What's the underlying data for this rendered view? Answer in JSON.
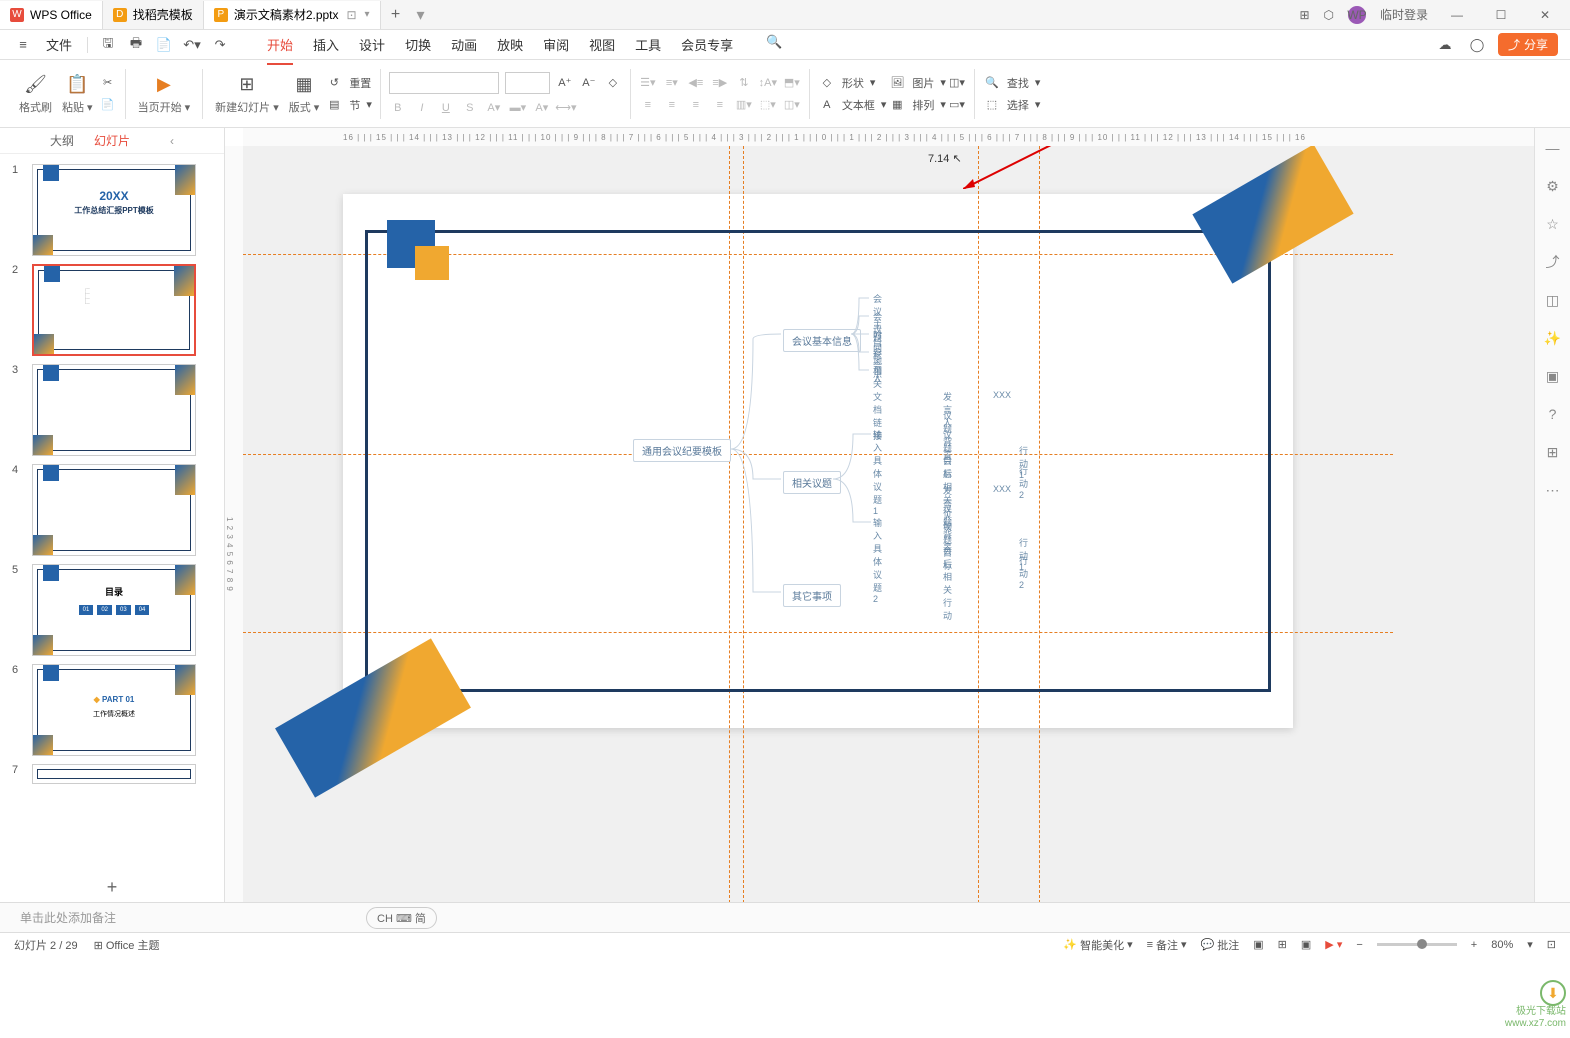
{
  "titlebar": {
    "tabs": [
      {
        "icon": "W",
        "label": "WPS Office",
        "iconColor": "red"
      },
      {
        "icon": "D",
        "label": "找稻壳模板",
        "iconColor": "orange"
      },
      {
        "icon": "P",
        "label": "演示文稿素材2.pptx",
        "iconColor": "orange",
        "active": true
      }
    ],
    "login": "临时登录"
  },
  "menu": {
    "file": "文件",
    "tabs": [
      "开始",
      "插入",
      "设计",
      "切换",
      "动画",
      "放映",
      "审阅",
      "视图",
      "工具",
      "会员专享"
    ],
    "activeTab": "开始",
    "share": "分享"
  },
  "ribbon": {
    "formatBrush": "格式刷",
    "paste": "粘贴",
    "startSlide": "当页开始",
    "newSlide": "新建幻灯片",
    "layout": "版式",
    "reset": "重置",
    "section": "节",
    "shape": "形状",
    "picture": "图片",
    "textbox": "文本框",
    "arrange": "排列",
    "find": "查找",
    "select": "选择"
  },
  "panel": {
    "outline": "大纲",
    "slides": "幻灯片"
  },
  "canvas": {
    "cursorValue": "7.14",
    "rulerH": "16 | | | 15 | | | 14 | | | 13 | | | 12 | | | 11 | | | 10 | | | 9 | | | 8 | | | 7 | | | 6 | | | 5 | | | 4 | | | 3 | | | 2 | | | 1 | | | 0 | | | 1 | | | 2 | | | 3 | | | 4 | | | 5 | | | 6 | | | 7 | | | 8 | | | 9 | | | 10 | | | 11 | | | 12 | | | 13 | | | 14 | | | 15 | | | 16",
    "rulerV": "1 2 3 4 5 6 7 8 9"
  },
  "mindmap": {
    "root": "通用会议纪要模板",
    "branch1": {
      "label": "会议基本信息",
      "children": [
        "会议主题",
        "会议目标",
        "时间地点",
        "参会人",
        "相关文档链接"
      ]
    },
    "branch2": {
      "label": "相关议题",
      "children": [
        {
          "label": "输入具体议题1",
          "sub": [
            "发言人",
            "议题背景",
            "议题目标"
          ],
          "xxx": "XXX",
          "action": "会后相关行动",
          "actions": [
            "行动 1",
            "行动 2"
          ]
        },
        {
          "label": "输入具体议题2",
          "sub": [
            "发言人",
            "议题背景",
            "议题目标"
          ],
          "xxx": "XXX",
          "action": "会后相关行动",
          "actions": [
            "行动 1",
            "行动 2"
          ]
        }
      ]
    },
    "branch3": {
      "label": "其它事项"
    }
  },
  "notes": {
    "placeholder": "单击此处添加备注",
    "ime": "CH ⌨ 简"
  },
  "status": {
    "slideInfo": "幻灯片 2 / 29",
    "theme": "Office 主题",
    "beautify": "智能美化",
    "notes": "备注",
    "comments": "批注",
    "zoom": "80%"
  },
  "thumbs": {
    "slide1": {
      "title": "20XX",
      "subtitle": "工作总结汇报PPT模板"
    },
    "slide5": {
      "title": "目录",
      "items": [
        "01",
        "02",
        "03",
        "04"
      ]
    },
    "slide6": {
      "title": "PART 01",
      "subtitle": "工作情况概述"
    }
  },
  "watermark": {
    "site": "极光下载站",
    "url": "www.xz7.com"
  }
}
